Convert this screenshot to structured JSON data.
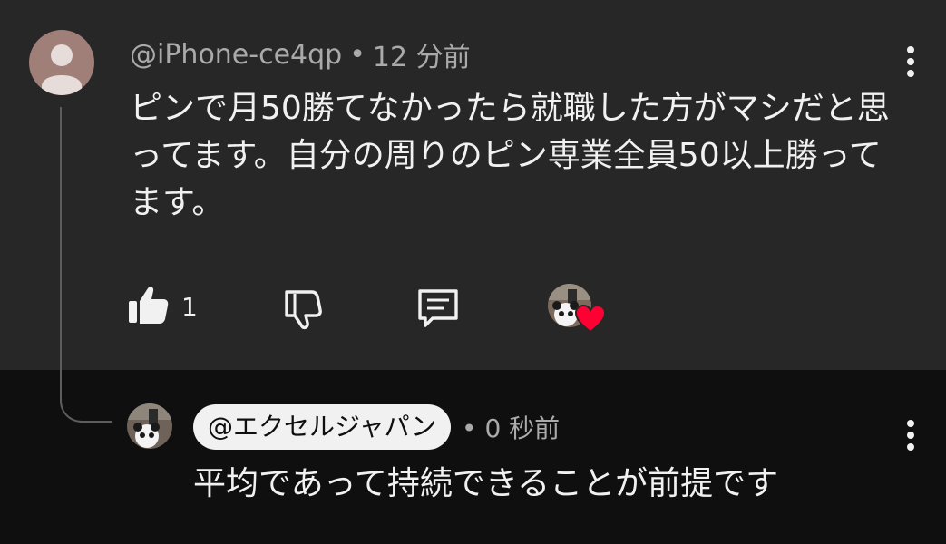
{
  "comment": {
    "author": "@iPhone-ce4qp",
    "separator": "•",
    "time": "12 分前",
    "text": "ピンで月50勝てなかったら就職した方がマシだと思ってます。自分の周りのピン専業全員50以上勝ってます。",
    "like_count": "1",
    "icons": {
      "avatar": "default-user-avatar-icon",
      "like": "thumbs-up-filled-icon",
      "dislike": "thumbs-down-icon",
      "reply": "reply-comment-icon",
      "creator_heart": "creator-heart-icon",
      "more": "more-vertical-icon"
    }
  },
  "reply": {
    "mention": "@エクセルジャパン",
    "separator": "•",
    "time": "0 秒前",
    "text": "平均であって持続できることが前提です",
    "icons": {
      "avatar": "channel-avatar-icon",
      "more": "more-vertical-icon"
    }
  },
  "colors": {
    "top_bg": "#272727",
    "bottom_bg": "#0f0f0f",
    "text_primary": "#f1f1f1",
    "text_secondary": "#aaaaaa",
    "heart": "#ff0033",
    "avatar_default": "#a07f78"
  }
}
